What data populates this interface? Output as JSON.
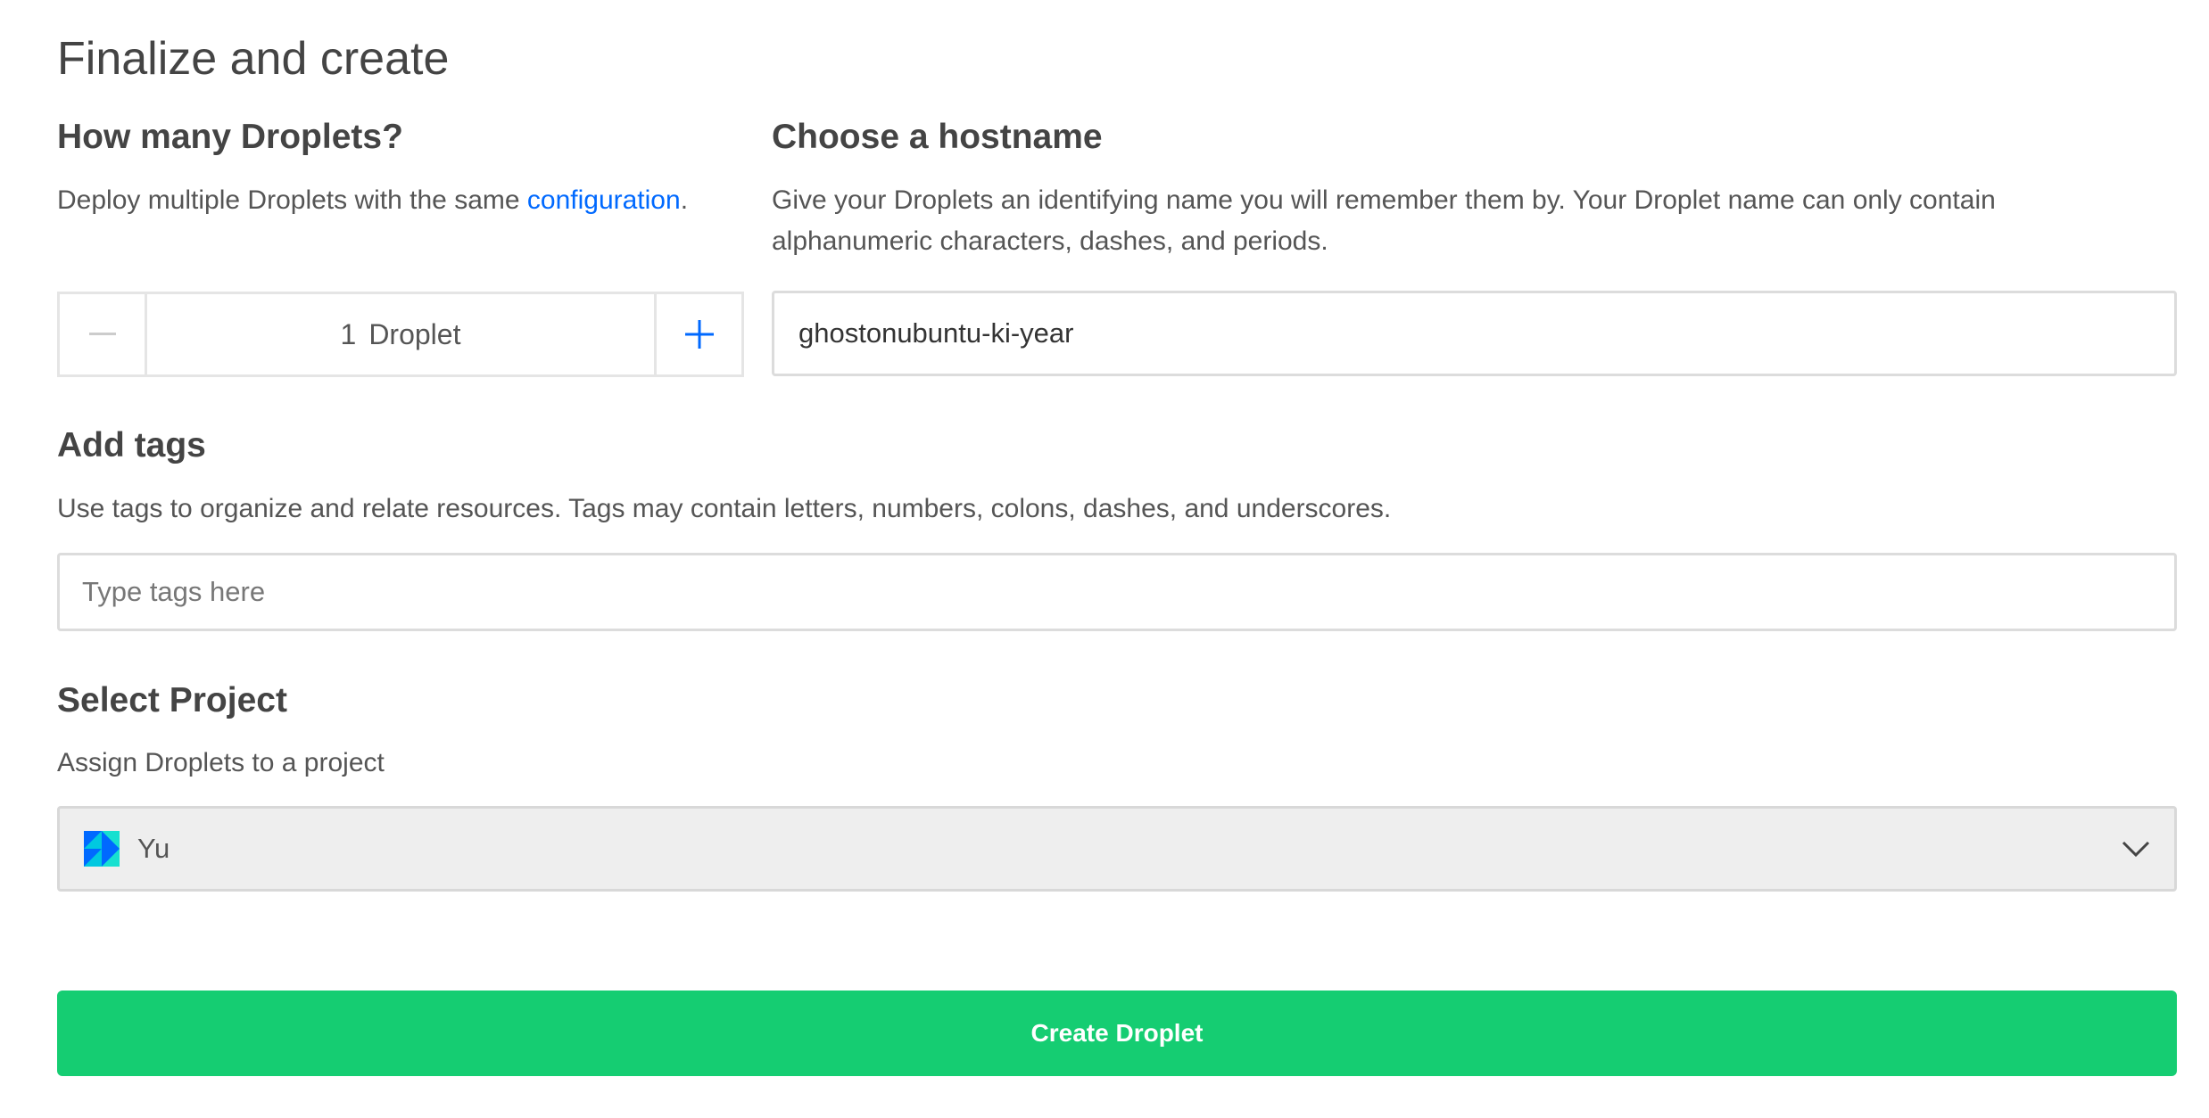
{
  "page": {
    "title": "Finalize and create"
  },
  "droplets": {
    "heading": "How many Droplets?",
    "desc_prefix": "Deploy multiple Droplets with the same ",
    "desc_link": "configuration",
    "desc_suffix": ".",
    "count": "1",
    "unit": "Droplet"
  },
  "hostname": {
    "heading": "Choose a hostname",
    "desc_line1": "Give your Droplets an identifying name you will remember them by. Your Droplet name can only contain",
    "desc_line2": "alphanumeric characters, dashes, and periods.",
    "value": "ghostonubuntu-ki-year"
  },
  "tags": {
    "heading": "Add tags",
    "desc": "Use tags to organize and relate resources. Tags may contain letters, numbers, colons, dashes, and underscores.",
    "placeholder": "Type tags here",
    "value": ""
  },
  "project": {
    "heading": "Select Project",
    "desc": "Assign Droplets to a project",
    "selected": "Yu"
  },
  "actions": {
    "create_label": "Create Droplet"
  },
  "colors": {
    "accent_link": "#0069ff",
    "create_button": "#15cd72",
    "text": "#444444"
  },
  "icons": {
    "decrement": "minus-icon",
    "increment": "plus-icon",
    "project": "project-logo-icon",
    "dropdown": "chevron-down-icon"
  }
}
